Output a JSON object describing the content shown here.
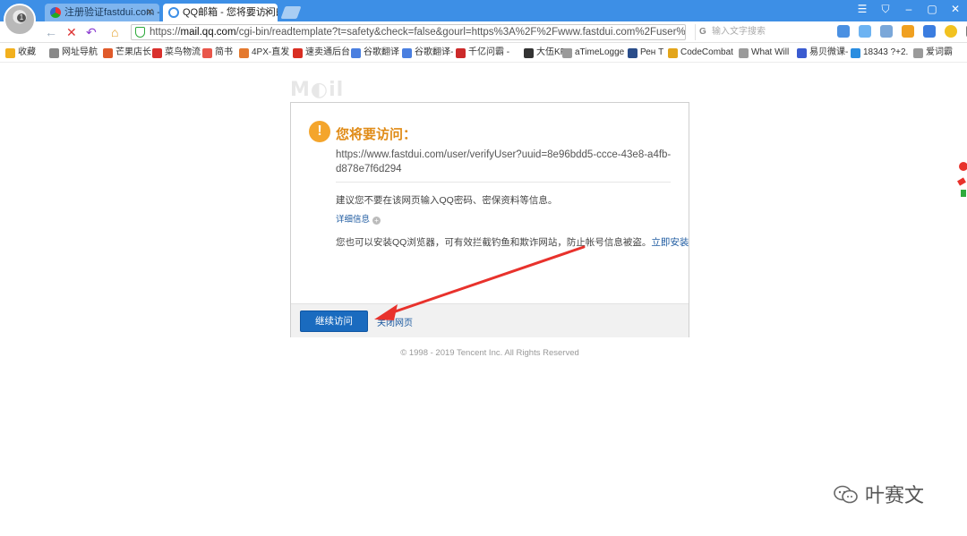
{
  "tabs": [
    {
      "label": "注册验证fastdui.com -",
      "close": "✕"
    },
    {
      "label": "QQ邮箱 - 您将要访问的",
      "close": "✕"
    }
  ],
  "window_buttons": [
    "☰",
    "⛉",
    "–",
    "▢",
    "✕"
  ],
  "nav": {
    "back": "←",
    "stop": "✕",
    "undo": "↶",
    "home": "⌂"
  },
  "address": {
    "scheme": "https://",
    "host": "mail.qq.com",
    "path": "/cgi-bin/readtemplate?t=safety&check=false&gourl=https%3A%2F%2Fwww.fastdui.com%2Fuser%"
  },
  "search": {
    "placeholder": "输入文字搜索",
    "engine": "G"
  },
  "bookmarks": [
    {
      "label": "收藏",
      "icon": "star-icon",
      "color": "#f2b01e"
    },
    {
      "label": "网址导航",
      "icon": "globe-icon",
      "color": "#888888"
    },
    {
      "label": "芒果店长",
      "icon": "mango-icon",
      "color": "#e05a2a"
    },
    {
      "label": "菜鸟物流",
      "icon": "cainiao-icon",
      "color": "#d9302c"
    },
    {
      "label": "简书",
      "icon": "jianshu-icon",
      "color": "#e9564a"
    },
    {
      "label": "4PX-直发",
      "icon": "4px-icon",
      "color": "#e4792e"
    },
    {
      "label": "速卖通后台",
      "icon": "aliexpress-icon",
      "color": "#d92e22"
    },
    {
      "label": "谷歌翻译",
      "icon": "translate-icon",
      "color": "#4a7fe0"
    },
    {
      "label": "谷歌翻译-",
      "icon": "translate-icon",
      "color": "#4a7fe0"
    },
    {
      "label": "千亿问霸 -",
      "icon": "qianyi-icon",
      "color": "#cc2a2a"
    },
    {
      "label": "大伍KPC",
      "icon": "kpc-icon",
      "color": "#333333"
    },
    {
      "label": "aTimeLogge",
      "icon": "page-icon",
      "color": "#9a9a9a"
    },
    {
      "label": "Рен Т",
      "icon": "monitor-icon",
      "color": "#2a4d8a"
    },
    {
      "label": "CodeCombat",
      "icon": "codecombat-icon",
      "color": "#e3a51a"
    },
    {
      "label": "What Will",
      "icon": "page-icon",
      "color": "#9a9a9a"
    },
    {
      "label": "易贝微课-",
      "icon": "ebay-icon",
      "color": "#3a5bd0"
    },
    {
      "label": "18343 ?+2.",
      "icon": "globe-icon",
      "color": "#2a8de0"
    },
    {
      "label": "爱词霸",
      "icon": "page-icon",
      "color": "#9a9a9a"
    }
  ],
  "page": {
    "logo": "M◐il",
    "warning_icon": "!",
    "title": "您将要访问：",
    "url": "https://www.fastdui.com/user/verifyUser?uuid=8e96bdd5-ccce-43e8-a4fb-d878e7f6d294",
    "advice": "建议您不要在该网页输入QQ密码、密保资料等信息。",
    "details_link": "详细信息",
    "details_icon": "+",
    "install_note": "您也可以安装QQ浏览器，可有效拦截钓鱼和欺诈网站，防止帐号信息被盗。",
    "install_link": "立即安装",
    "continue_button": "继续访问",
    "close_link": "关闭网页",
    "copyright": "© 1998 - 2019 Tencent Inc. All Rights Reserved"
  },
  "watermark": {
    "text": "叶赛文"
  },
  "colors": {
    "titlebar": "#3d8fe6",
    "warning": "#e08b16",
    "primary_button": "#1a6bbf",
    "link": "#1d5aa0",
    "arrow": "#e8322c"
  }
}
